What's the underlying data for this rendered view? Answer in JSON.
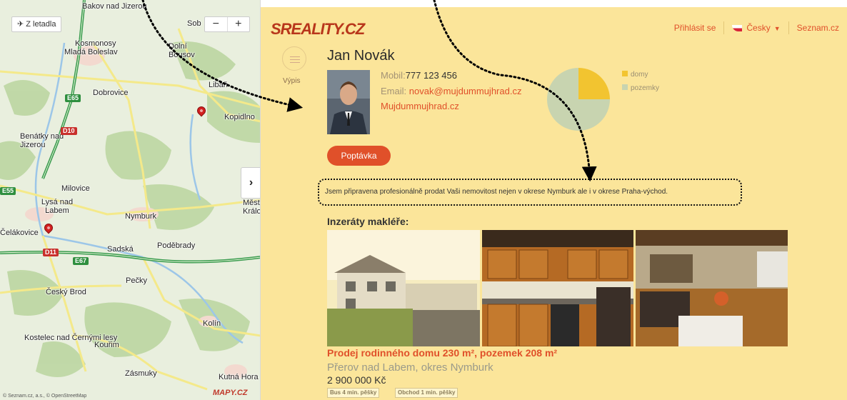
{
  "map": {
    "from_air_label": "Z letadla",
    "zoom_out": "−",
    "zoom_in": "+",
    "expand_glyph": "›",
    "logo": "MAPY.CZ",
    "copyright": "© Seznam.cz, a.s., © OpenStreetMap",
    "places": [
      "Bakov nad Jizerou",
      "Sob",
      "Kosmonosy",
      "Mladá Boleslav",
      "Dolní Bousov",
      "Dobrovice",
      "Libáň",
      "Kopidlno",
      "Benátky nad Jizerou",
      "Milovice",
      "Lysá nad Labem",
      "Nymburk",
      "Měst. Králové",
      "Čelákovice",
      "Sadská",
      "Poděbrady",
      "Pečky",
      "Český Brod",
      "Kolín",
      "Kostelec nad Černými lesy",
      "Kouřim",
      "Zásmuky",
      "Kutná Hora"
    ],
    "road_badges": [
      "E65",
      "D10",
      "D11",
      "E67",
      "E55"
    ]
  },
  "header": {
    "logo_text": "SREALITY.CZ",
    "login": "Přihlásit se",
    "language": "Česky",
    "seznam": "Seznam.cz"
  },
  "sidebar": {
    "list_label": "Výpis"
  },
  "agent": {
    "name": "Jan Novák",
    "mobile_label": "Mobil:",
    "mobile": "777 123 456",
    "email_label": "Email:",
    "email": "novak@mujdummujhrad.cz",
    "website": "Mujdummujhrad.cz",
    "inquiry_button": "Poptávka",
    "bio": "Jsem připravena profesionálně prodat Vaši nemovitost nejen v okrese Nymburk ale i v okrese Praha-východ."
  },
  "chart_data": {
    "type": "pie",
    "categories": [
      "domy",
      "pozemky"
    ],
    "values": [
      25,
      75
    ],
    "colors": [
      "#f2c430",
      "#c8d4b0"
    ],
    "legend_position": "right"
  },
  "listings": {
    "title": "Inzeráty makléře:",
    "items": [
      {
        "title": "Prodej rodinného domu 230 m², pozemek 208 m²",
        "location": "Přerov nad Labem, okres Nymburk",
        "price": "2 900 000 Kč",
        "tags": [
          "Bus 4 min. pěšky",
          "Obchod 1 min. pěšky"
        ]
      }
    ]
  }
}
